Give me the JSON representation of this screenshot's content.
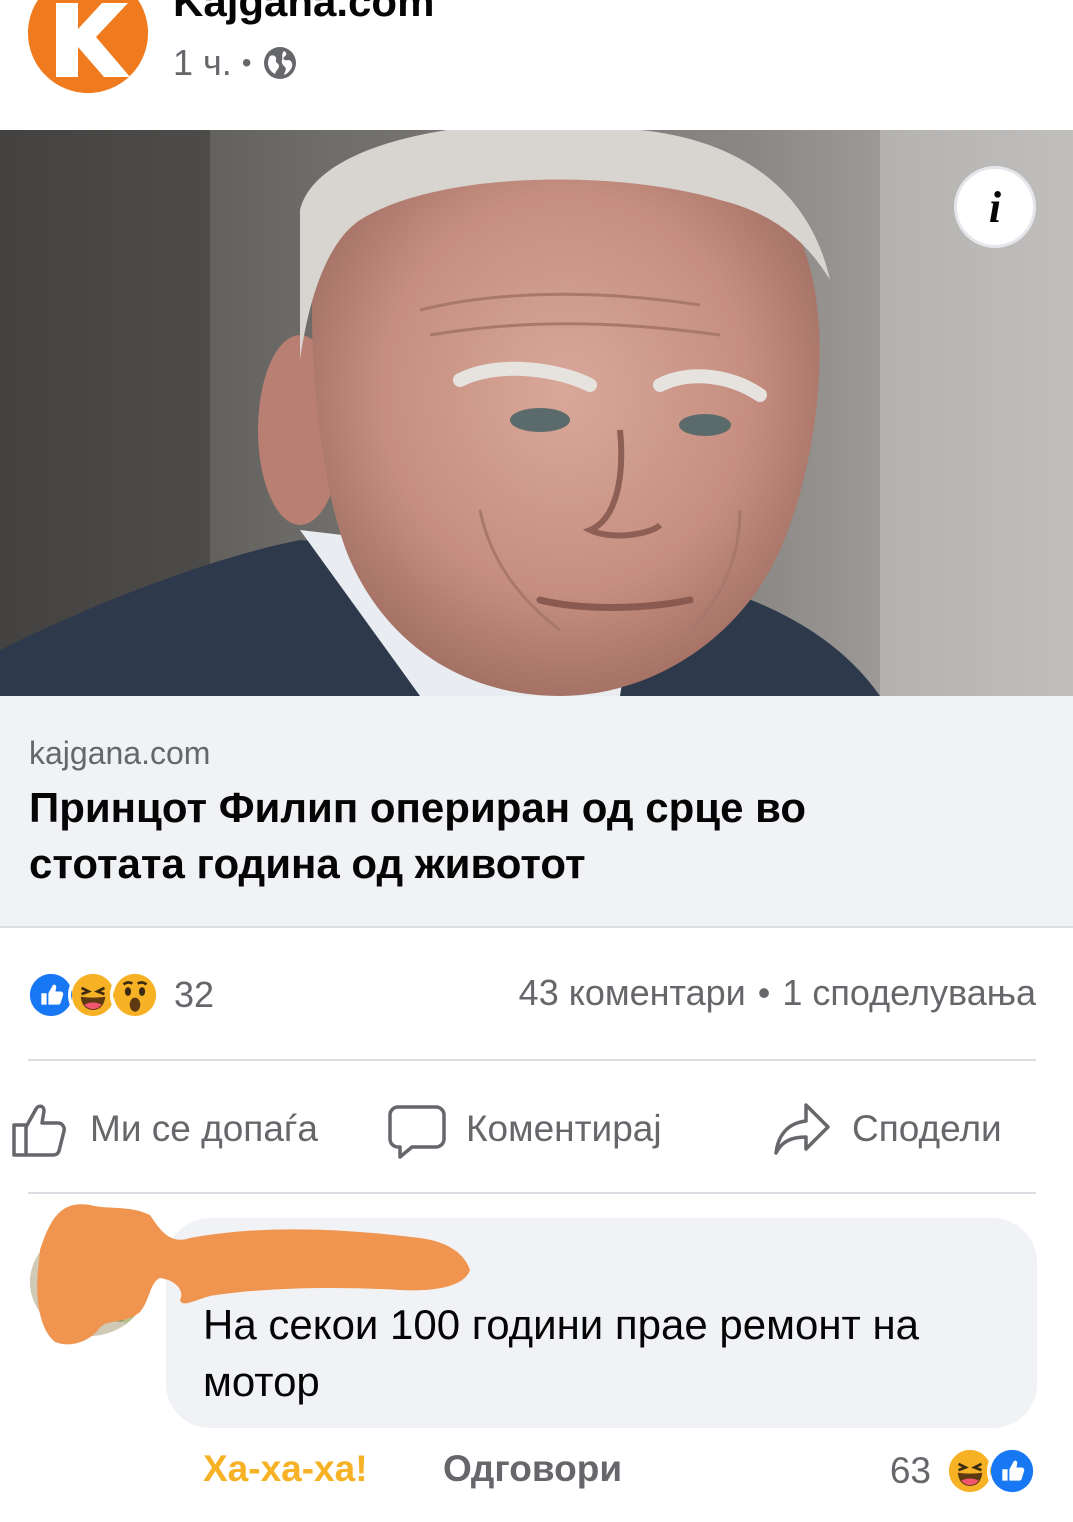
{
  "colors": {
    "brand_orange": "#f07b1e",
    "like_blue": "#1877f2",
    "haha_yellow": "#f7b125",
    "text_secondary": "#65676b"
  },
  "post": {
    "page_name": "Kajgana.com",
    "time": "1 ч.",
    "privacy_icon": "globe-icon"
  },
  "link": {
    "domain": "kajgana.com",
    "title": "Принцот Филип опериран од срце во стотата година од животот"
  },
  "stats": {
    "reaction_icons": [
      "like-icon",
      "haha-icon",
      "wow-icon"
    ],
    "reaction_count": "32",
    "comments": "43 коментари",
    "separator": "•",
    "shares": "1 споделувања"
  },
  "actions": {
    "like": "Ми се допаѓа",
    "comment": "Коментирај",
    "share": "Сподели"
  },
  "comment": {
    "text": "На секои 100 години прае ремонт на мотор",
    "reaction_label": "Ха-ха-ха!",
    "reply_label": "Одговори",
    "reaction_count": "63",
    "reaction_icons": [
      "haha-icon",
      "like-icon"
    ]
  }
}
